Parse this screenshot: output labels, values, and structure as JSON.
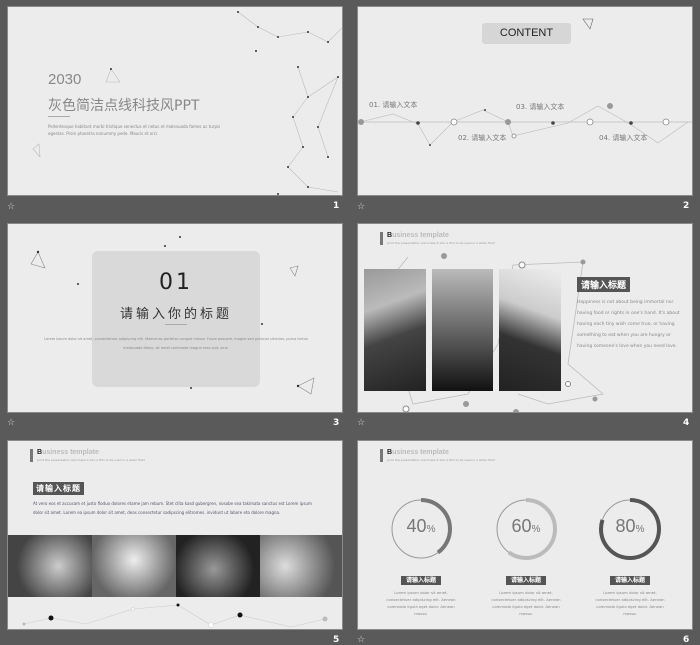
{
  "slides": [
    {
      "number": "1",
      "year": "2030",
      "title": "灰色简洁点线科技风PPT",
      "body": "Pellentesque habitant morbi tristique senectus et netus et malesuada fames ac turpis egestas.  Proin pharetra nonummy pede. Mauris et orci."
    },
    {
      "number": "2",
      "heading": "CONTENT",
      "items": [
        "01. 请输入文本",
        "02. 请输入文本",
        "03. 请输入文本",
        "04. 请输入文本"
      ]
    },
    {
      "number": "3",
      "section": "01",
      "title": "请输入你的标题",
      "body": "Lorem ipsum dolor sit amet, consectetuer adipiscing elit. Maecenas porttitor congue massa. Fusce posuere, magna sed pulvinar ultricies, purus lectus malesuada libero, sit amet commodo magna eros quis urna."
    },
    {
      "number": "4",
      "header": {
        "first": "B",
        "rest": "usiness  template",
        "sub": "print the presentation and make it into a film to be used in a wider field"
      },
      "tag": "请输入标题",
      "body": "Happiness is not about being immortal nor having food or rights in one's hand. It's about having each tiny wish come true, or having something to eat when you are hungry or having someone's love when you need love."
    },
    {
      "number": "5",
      "header": {
        "first": "B",
        "rest": "usiness  template",
        "sub": "print the presentation and make it into a film to be used in a wider field"
      },
      "tag": "请输入标题",
      "body": "At vero eos et accusam et justo floduo dolores etame jam rebum. Stet clita kasd gubergren, nosobe sea takimata sanctus est Lorem ipsum dolor sit amet. Lorem ea ipsum dolor sit amet, deas consectetur sadipscing elitromes. invidunt ut labore eto dolore magna."
    },
    {
      "number": "6",
      "header": {
        "first": "B",
        "rest": "usiness  template",
        "sub": "print the presentation and make it into a film to be used in a wider field"
      },
      "stats": [
        {
          "value": "40",
          "unit": "%",
          "progress": 40,
          "color": "#777777",
          "tag": "请输入标题",
          "body": "Lorem ipsum dolor sit amet, consectetuer adipiscing elit. Aenean commodo ligula eget dolor. Aenean massa."
        },
        {
          "value": "60",
          "unit": "%",
          "progress": 60,
          "color": "#bbbbbb",
          "tag": "请输入标题",
          "body": "Lorem ipsum dolor sit amet, consectetuer adipiscing elit. Aenean commodo ligula eget dolor. Aenean massa."
        },
        {
          "value": "80",
          "unit": "%",
          "progress": 80,
          "color": "#555555",
          "tag": "请输入标题",
          "body": "Lorem ipsum dolor sit amet, consectetuer adipiscing elit. Aenean commodo ligula eget dolor. Aenean massa."
        }
      ]
    }
  ],
  "icons": {
    "transition": "star-icon"
  }
}
